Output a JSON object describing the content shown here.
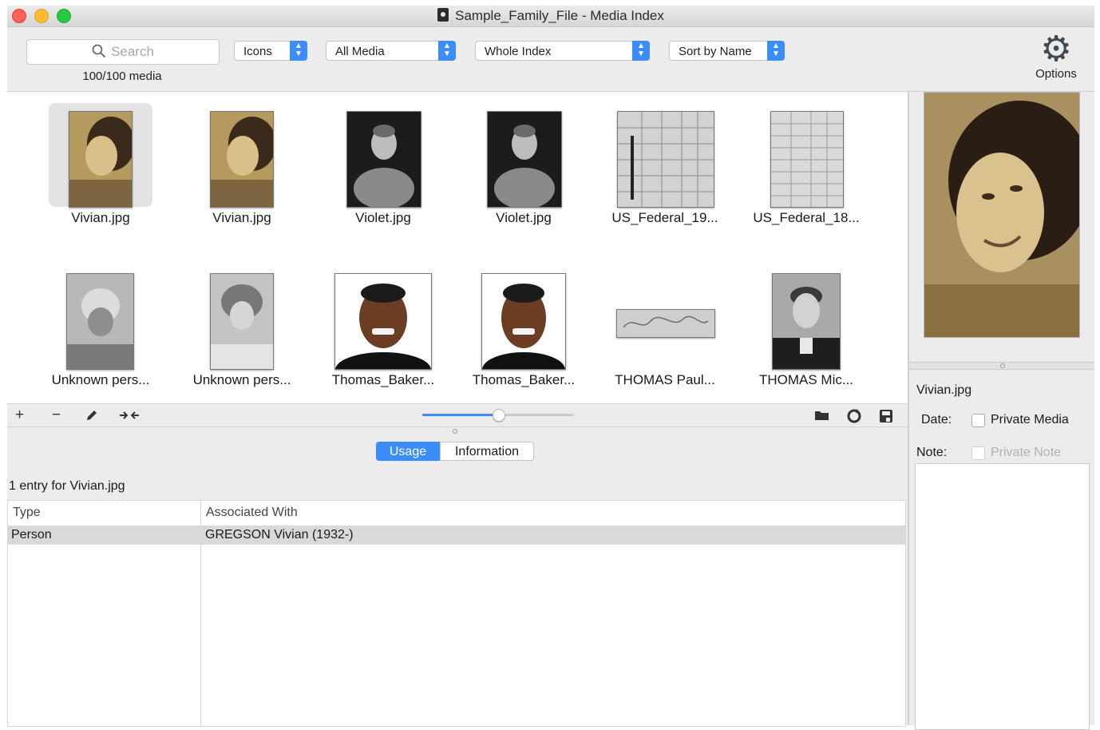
{
  "window": {
    "title": "Sample_Family_File - Media Index"
  },
  "toolbar": {
    "search_placeholder": "Search",
    "media_count": "100/100 media",
    "view_mode": "Icons",
    "media_filter": "All Media",
    "scope": "Whole Index",
    "sort": "Sort by Name",
    "options_label": "Options"
  },
  "media": [
    {
      "label": "Vivian.jpg",
      "kind": "sepia-portrait",
      "selected": true
    },
    {
      "label": "Vivian.jpg",
      "kind": "sepia-portrait",
      "selected": false
    },
    {
      "label": "Violet.jpg",
      "kind": "bw-portrait",
      "selected": false
    },
    {
      "label": "Violet.jpg",
      "kind": "bw-portrait",
      "selected": false
    },
    {
      "label": "US_Federal_19...",
      "kind": "census-document",
      "selected": false
    },
    {
      "label": "US_Federal_18...",
      "kind": "census-document",
      "selected": false
    },
    {
      "label": "Unknown pers...",
      "kind": "faded-portrait",
      "selected": false
    },
    {
      "label": "Unknown pers...",
      "kind": "faded-portrait",
      "selected": false
    },
    {
      "label": "Thomas_Baker...",
      "kind": "color-portrait",
      "selected": false
    },
    {
      "label": "Thomas_Baker...",
      "kind": "color-portrait",
      "selected": false
    },
    {
      "label": "THOMAS Paul...",
      "kind": "signature",
      "selected": false
    },
    {
      "label": "THOMAS Mic...",
      "kind": "bw-portrait-man",
      "selected": false
    }
  ],
  "bottom_bar": {
    "add_label": "+",
    "remove_label": "−",
    "thumbnail_size_fraction": 0.5
  },
  "tabs": {
    "usage": "Usage",
    "information": "Information"
  },
  "usage": {
    "entry_count": "1 entry for Vivian.jpg",
    "columns": [
      "Type",
      "Associated With"
    ],
    "rows": [
      {
        "type": "Person",
        "associated_with": "GREGSON Vivian (1932-)"
      }
    ]
  },
  "details": {
    "filename": "Vivian.jpg",
    "date_label": "Date:",
    "private_media_label": "Private Media",
    "note_label": "Note:",
    "private_note_label": "Private Note"
  },
  "colors": {
    "accent": "#3b8dfc",
    "toolbar_bg": "#ececec",
    "selection_row": "#d9d9d9"
  }
}
